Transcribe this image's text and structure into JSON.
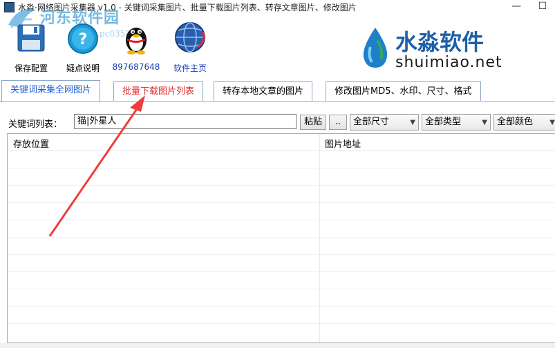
{
  "window": {
    "title": "水淼·网络图片采集器 v1.0 - 关键词采集图片、批量下载图片列表、转存文章图片、修改图片",
    "minimize": "—",
    "maximize": "☐"
  },
  "watermark": {
    "site_name": "河东软件园",
    "site_url": "www.pc0359.cn"
  },
  "toolbar": {
    "items": [
      {
        "label": "保存配置",
        "icon": "floppy-disk-icon"
      },
      {
        "label": "疑点说明",
        "icon": "help-icon"
      },
      {
        "label": "897687648",
        "icon": "qq-penguin-icon"
      },
      {
        "label": "软件主页",
        "icon": "globe-icon"
      }
    ]
  },
  "brand": {
    "name_cn": "水淼软件",
    "name_en": "shuimiao.net"
  },
  "tabs": [
    {
      "label": "关键词采集全网图片",
      "active": true
    },
    {
      "label": "批量下载图片列表",
      "active": false
    },
    {
      "label": "转存本地文章的图片",
      "active": false
    },
    {
      "label": "修改图片MD5、水印、尺寸、格式",
      "active": false
    }
  ],
  "keyword": {
    "label": "关键词列表：",
    "value": "猫|外星人",
    "paste_button": "粘贴",
    "more_button": ".."
  },
  "filters": {
    "size": "全部尺寸",
    "type": "全部类型",
    "color": "全部颜色"
  },
  "list": {
    "columns": [
      "存放位置",
      "图片地址"
    ]
  },
  "colors": {
    "active_tab": "#1f5fd8",
    "red_tab": "#e03030",
    "annotation_arrow": "#f03c3c",
    "brand_blue": "#1f5fa8"
  }
}
